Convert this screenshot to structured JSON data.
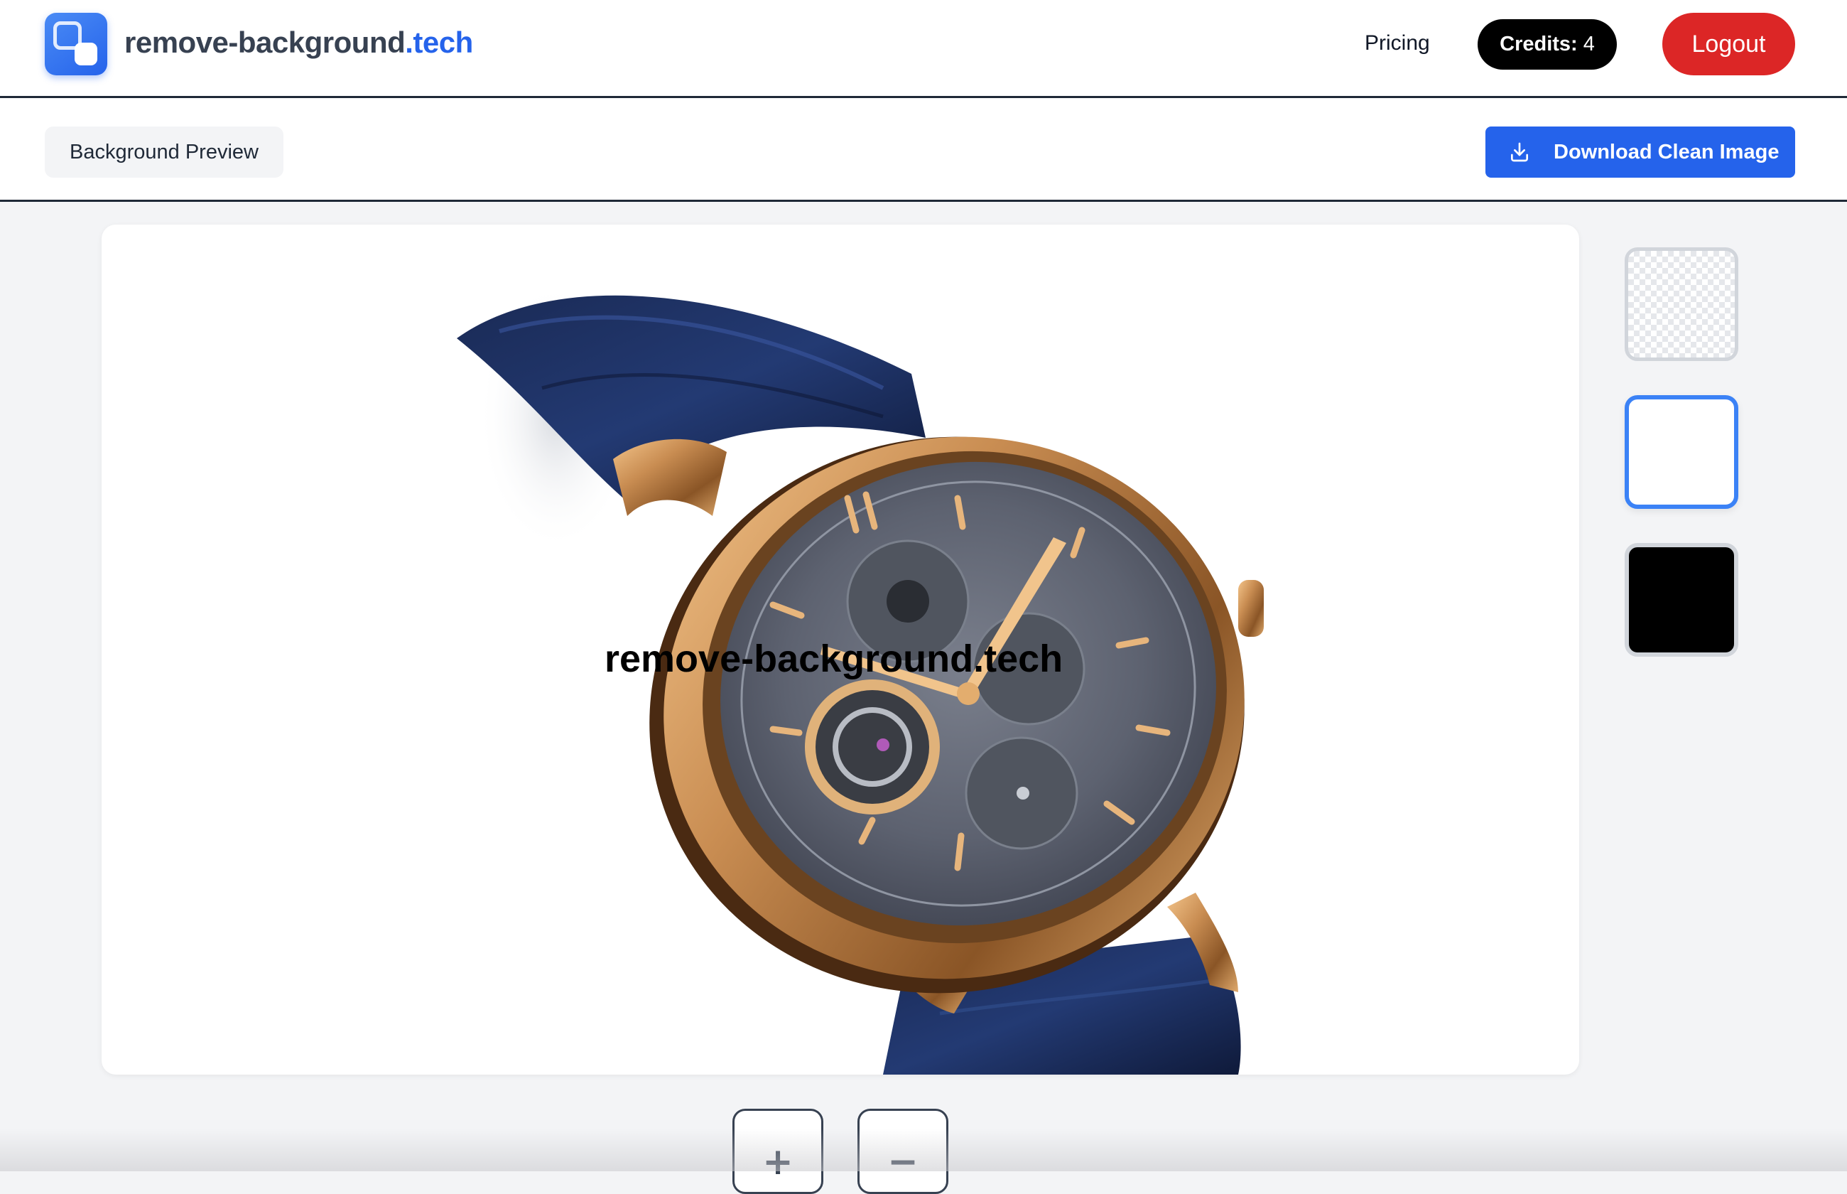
{
  "header": {
    "brand_name": "remove-background",
    "brand_tld": ".tech",
    "pricing_label": "Pricing",
    "credits_label": "Credits:",
    "credits_value": "4",
    "logout_label": "Logout"
  },
  "toolbar": {
    "background_preview_label": "Background Preview",
    "download_label": "Download Clean Image",
    "download_icon": "download-icon"
  },
  "canvas": {
    "watermark_text": "remove-background.tech",
    "subject": "wristwatch"
  },
  "background_options": [
    {
      "name": "transparent",
      "selected": false
    },
    {
      "name": "white",
      "color": "#ffffff",
      "selected": true
    },
    {
      "name": "black",
      "color": "#000000",
      "selected": false
    }
  ],
  "zoom": {
    "zoom_in_label": "+",
    "zoom_out_label": "−"
  },
  "colors": {
    "accent": "#2563eb",
    "logout": "#dc2626",
    "credits_bg": "#000000",
    "selected_border": "#3b82f6"
  }
}
